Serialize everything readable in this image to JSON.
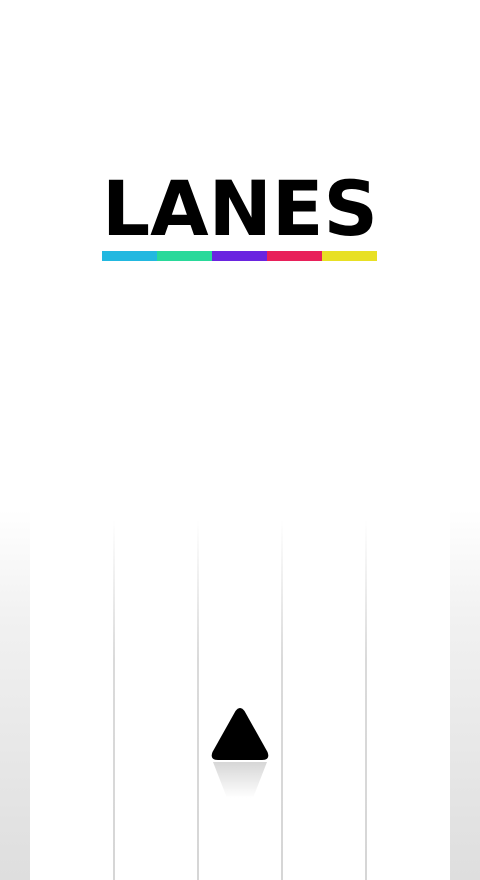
{
  "game": {
    "title": "LANES",
    "lane_count": 5,
    "player_lane": 3,
    "player_icon": "triangle-icon"
  },
  "title_colors": [
    "#22b8e0",
    "#29d99a",
    "#6a24e0",
    "#e8205a",
    "#e8e024"
  ],
  "colors": {
    "text": "#000000",
    "background": "#ffffff"
  }
}
